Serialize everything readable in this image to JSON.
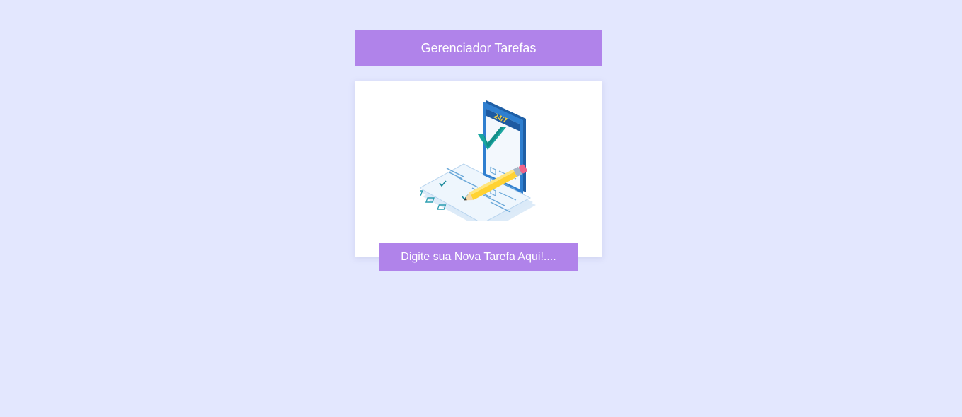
{
  "header": {
    "title": "Gerenciador Tarefas"
  },
  "card": {
    "illustration": {
      "icon": "task-checklist-phone-illustration",
      "phone_badge": "24/7"
    },
    "task_input": {
      "placeholder": "Digite sua Nova Tarefa Aqui!....",
      "value": ""
    }
  },
  "colors": {
    "background": "#e3e7fe",
    "accent": "#b083ea",
    "card": "#ffffff"
  }
}
